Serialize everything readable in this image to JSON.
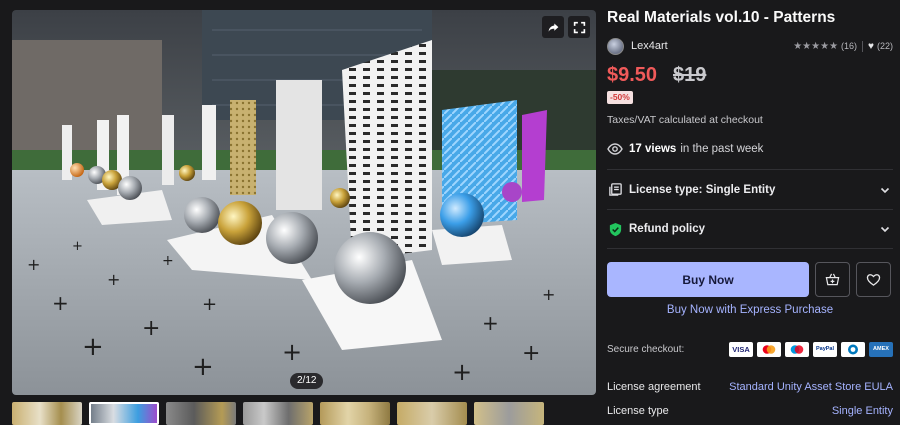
{
  "gallery": {
    "counter": "2/12",
    "thumbnail_count": 7,
    "active_thumbnail": 1
  },
  "product": {
    "title": "Real Materials vol.10 - Patterns",
    "publisher": "Lex4art",
    "rating_stars": 5,
    "rating_count": "(16)",
    "favorites_count": "(22)",
    "price": "$9.50",
    "original_price": "$19",
    "discount": "-50%",
    "tax_note": "Taxes/VAT calculated at checkout"
  },
  "views": {
    "count": "17 views",
    "suffix": "in the past week"
  },
  "accordions": {
    "license": "License type: Single Entity",
    "refund": "Refund policy"
  },
  "actions": {
    "buy_now": "Buy Now",
    "express": "Buy Now with Express Purchase"
  },
  "checkout": {
    "secure_label": "Secure checkout:",
    "cards": [
      {
        "name": "VISA",
        "bg": "#ffffff",
        "fg": "#1a1f71"
      },
      {
        "name": "MC",
        "bg": "#ffffff",
        "fg": "#eb001b"
      },
      {
        "name": "Maestro",
        "bg": "#ffffff",
        "fg": "#0099df"
      },
      {
        "name": "PayPal",
        "bg": "#ffffff",
        "fg": "#003087"
      },
      {
        "name": "Diners",
        "bg": "#ffffff",
        "fg": "#0079be"
      },
      {
        "name": "AMEX",
        "bg": "#2671b9",
        "fg": "#ffffff"
      }
    ]
  },
  "info": {
    "agreement_label": "License agreement",
    "agreement_value": "Standard Unity Asset Store EULA",
    "type_label": "License type",
    "type_value": "Single Entity"
  },
  "colors": {
    "accent": "#a9b6ff",
    "link": "#a5b3ff",
    "sale": "#f05a5a",
    "background": "#19191b",
    "shield": "#22c55e"
  }
}
